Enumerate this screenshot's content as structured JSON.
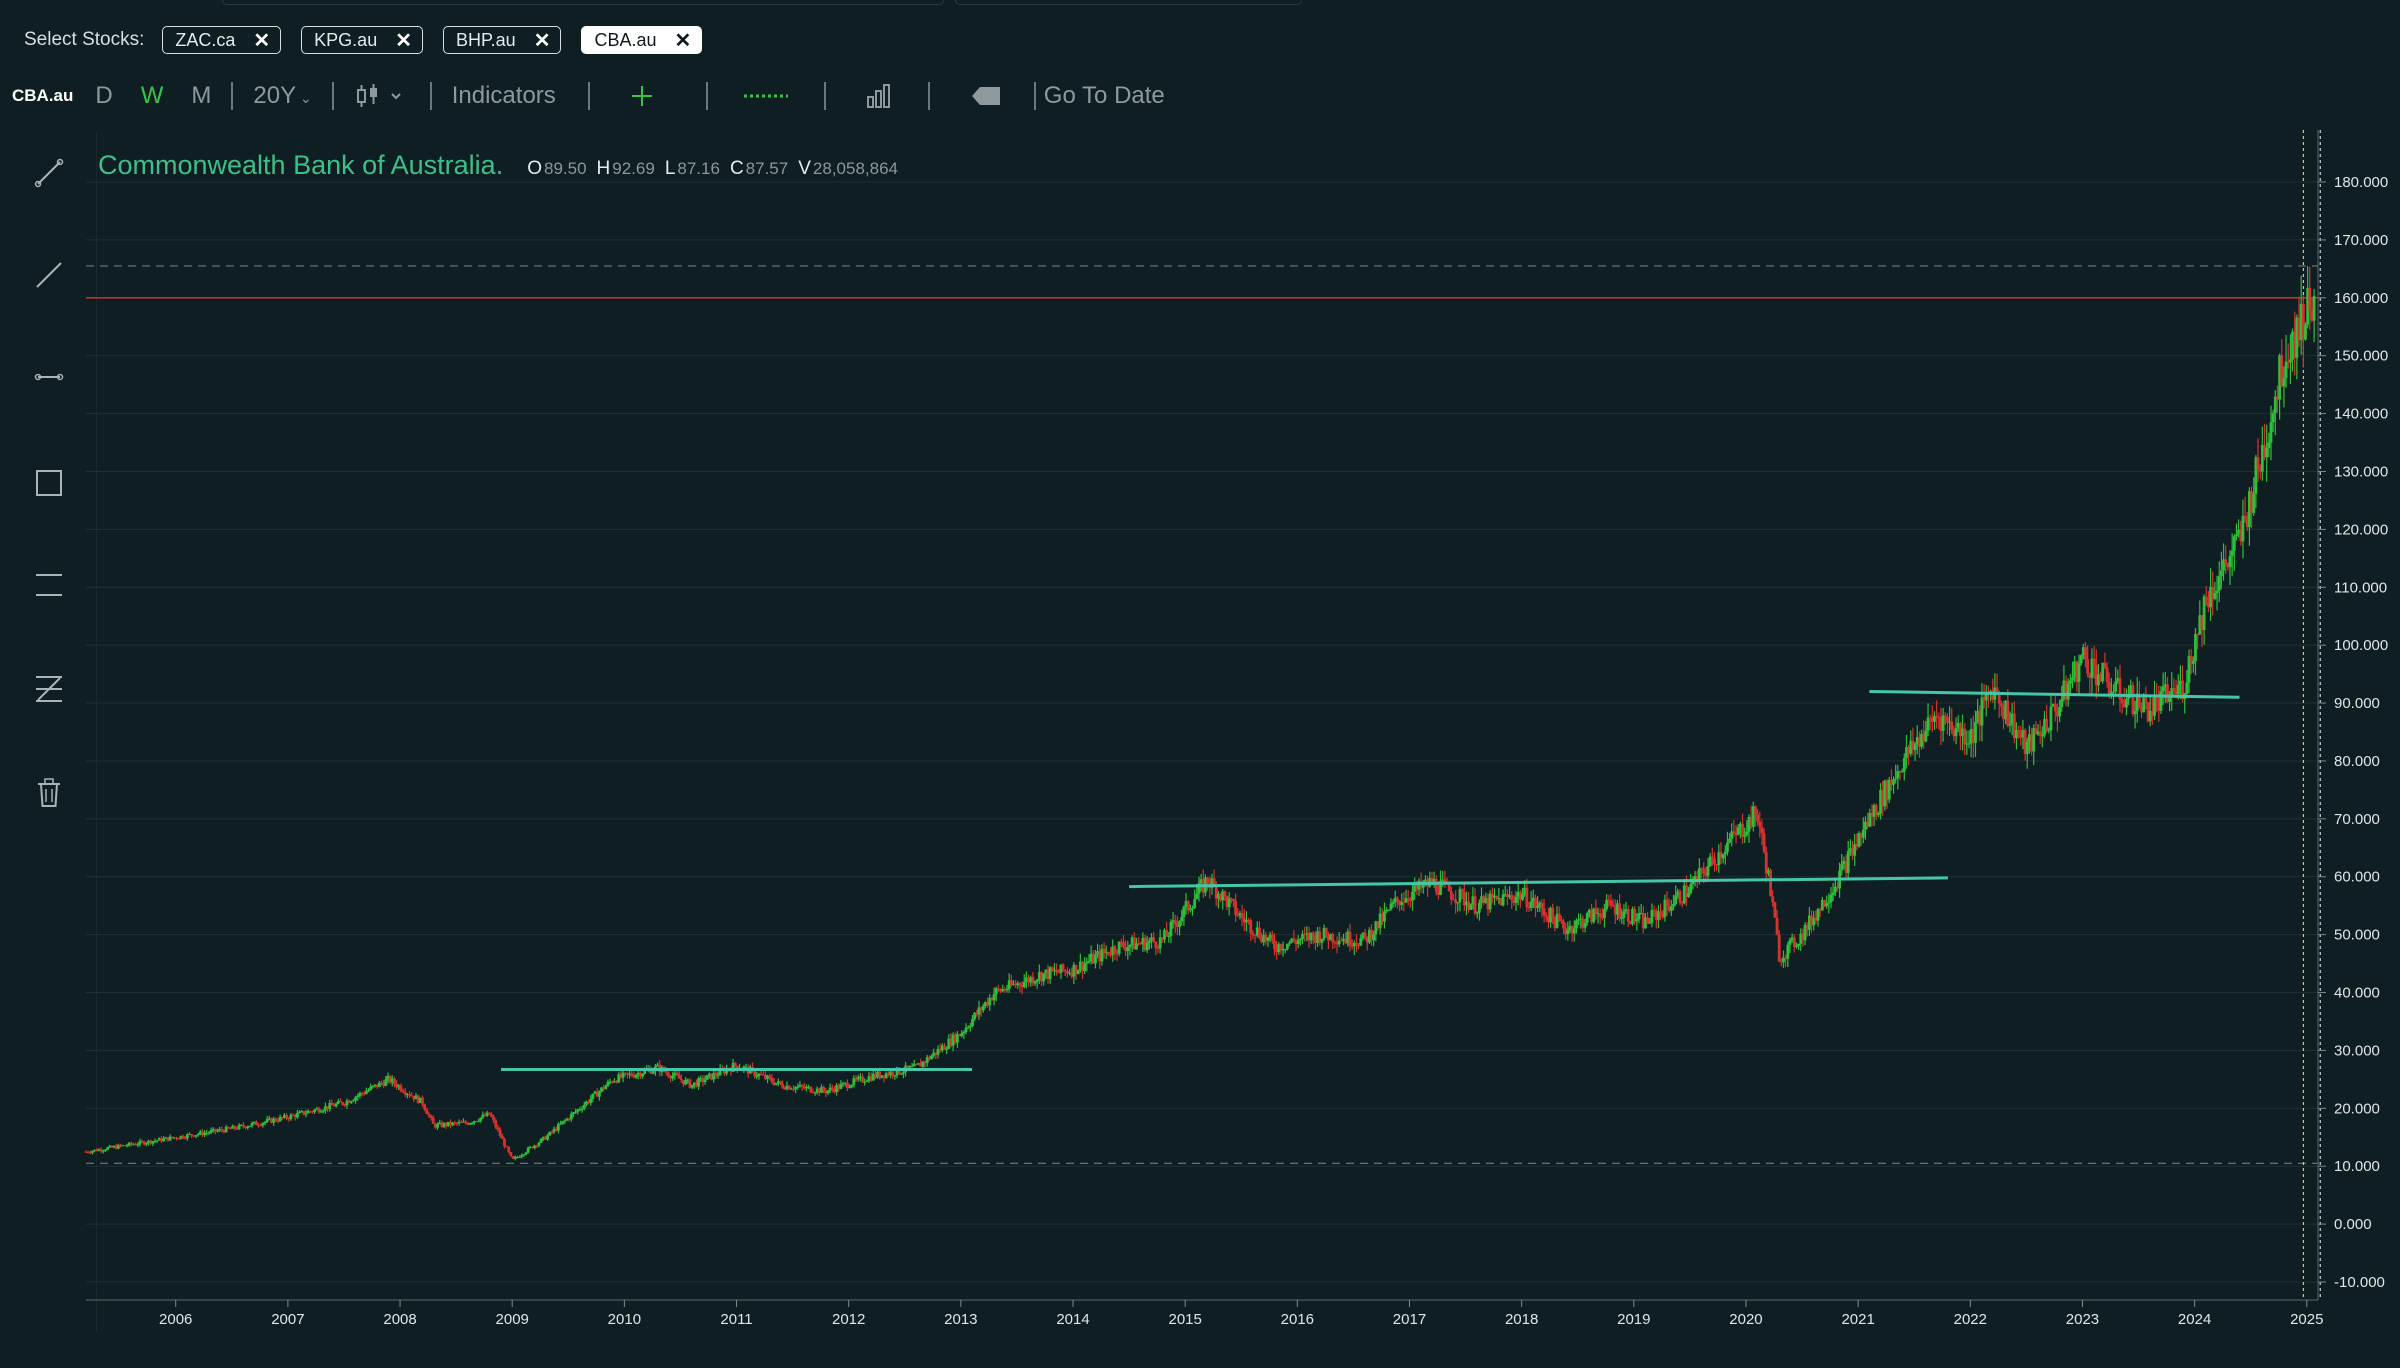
{
  "stock_select": {
    "label": "Select Stocks:",
    "chips": [
      {
        "label": "ZAC.ca",
        "active": false
      },
      {
        "label": "KPG.au",
        "active": false
      },
      {
        "label": "BHP.au",
        "active": false
      },
      {
        "label": "CBA.au",
        "active": true
      }
    ]
  },
  "toolbar": {
    "symbol": "CBA.au",
    "intervals": [
      "D",
      "W",
      "M"
    ],
    "selected_interval": "W",
    "range": "20Y",
    "indicators_label": "Indicators",
    "goto_label": "Go To Date"
  },
  "drawing_tools": [
    "trend-line-icon",
    "ray-icon",
    "segment-icon",
    "rectangle-icon",
    "horizontal-lines-icon",
    "fib-icon",
    "trash-icon"
  ],
  "legend": {
    "title": "Commonwealth Bank of Australia.",
    "o_key": "O",
    "open": "89.50",
    "h_key": "H",
    "high": "92.69",
    "l_key": "L",
    "low": "87.16",
    "c_key": "C",
    "close": "87.57",
    "v_key": "V",
    "volume": "28,058,864"
  },
  "colors": {
    "background": "#0f1e22",
    "up": "#2fbf3a",
    "down": "#d6332f",
    "trendline": "#46c6a8",
    "resistance": "#c2302b",
    "active_interval": "#36c44a"
  },
  "chart_data": {
    "type": "candlestick",
    "title": "Commonwealth Bank of Australia.",
    "x_start": 2005.2,
    "x_end": 2025.1,
    "xticks": [
      "2006",
      "2007",
      "2008",
      "2009",
      "2010",
      "2011",
      "2012",
      "2013",
      "2014",
      "2015",
      "2016",
      "2017",
      "2018",
      "2019",
      "2020",
      "2021",
      "2022",
      "2023",
      "2024",
      "2025"
    ],
    "yticks": [
      "-10.000",
      "0.000",
      "10.000",
      "20.000",
      "30.000",
      "40.000",
      "50.000",
      "60.000",
      "70.000",
      "80.000",
      "90.000",
      "100.000",
      "110.000",
      "120.000",
      "130.000",
      "140.000",
      "150.000",
      "160.000",
      "170.000",
      "180.000"
    ],
    "ylim": [
      -10,
      180
    ],
    "price_path": [
      [
        2005.2,
        12.5
      ],
      [
        2006.0,
        15.0
      ],
      [
        2006.5,
        16.5
      ],
      [
        2007.0,
        18.5
      ],
      [
        2007.5,
        21.0
      ],
      [
        2007.9,
        25.0
      ],
      [
        2008.2,
        21.0
      ],
      [
        2008.3,
        17.0
      ],
      [
        2008.6,
        17.5
      ],
      [
        2008.8,
        19.0
      ],
      [
        2009.0,
        11.0
      ],
      [
        2009.3,
        15.0
      ],
      [
        2009.6,
        20.0
      ],
      [
        2009.9,
        25.0
      ],
      [
        2010.3,
        27.0
      ],
      [
        2010.6,
        24.0
      ],
      [
        2011.0,
        27.5
      ],
      [
        2011.4,
        24.0
      ],
      [
        2011.8,
        23.0
      ],
      [
        2012.2,
        25.5
      ],
      [
        2012.6,
        27.0
      ],
      [
        2013.0,
        33.0
      ],
      [
        2013.3,
        40.0
      ],
      [
        2013.7,
        43.0
      ],
      [
        2014.0,
        44.0
      ],
      [
        2014.4,
        48.0
      ],
      [
        2014.8,
        49.0
      ],
      [
        2015.2,
        59.5
      ],
      [
        2015.5,
        53.0
      ],
      [
        2015.8,
        48.0
      ],
      [
        2016.2,
        50.0
      ],
      [
        2016.6,
        49.0
      ],
      [
        2016.9,
        56.0
      ],
      [
        2017.2,
        59.0
      ],
      [
        2017.6,
        55.0
      ],
      [
        2018.0,
        57.0
      ],
      [
        2018.4,
        51.0
      ],
      [
        2018.8,
        55.0
      ],
      [
        2019.1,
        52.0
      ],
      [
        2019.5,
        58.0
      ],
      [
        2019.8,
        65.0
      ],
      [
        2020.1,
        71.0
      ],
      [
        2020.2,
        60.0
      ],
      [
        2020.3,
        46.0
      ],
      [
        2020.5,
        50.0
      ],
      [
        2020.8,
        59.0
      ],
      [
        2021.1,
        70.0
      ],
      [
        2021.4,
        80.0
      ],
      [
        2021.7,
        88.0
      ],
      [
        2022.0,
        84.0
      ],
      [
        2022.2,
        93.0
      ],
      [
        2022.5,
        82.0
      ],
      [
        2022.8,
        90.0
      ],
      [
        2023.0,
        98.0
      ],
      [
        2023.3,
        92.0
      ],
      [
        2023.6,
        89.0
      ],
      [
        2023.9,
        93.0
      ],
      [
        2024.1,
        108.0
      ],
      [
        2024.4,
        118.0
      ],
      [
        2024.6,
        133.0
      ],
      [
        2024.8,
        150.0
      ],
      [
        2025.0,
        158.0
      ],
      [
        2025.08,
        162.0
      ]
    ],
    "seed": 7,
    "trendlines": [
      {
        "x1": 2008.9,
        "y1": 26.7,
        "x2": 2013.1,
        "y2": 26.7
      },
      {
        "x1": 2014.5,
        "y1": 58.3,
        "x2": 2021.8,
        "y2": 59.8
      },
      {
        "x1": 2021.1,
        "y1": 92.0,
        "x2": 2024.4,
        "y2": 91.0
      }
    ],
    "resistance_level": 160,
    "dashed_levels": [
      165.5,
      10.5
    ],
    "cursor_dates": [
      2024.97,
      2025.12
    ]
  }
}
